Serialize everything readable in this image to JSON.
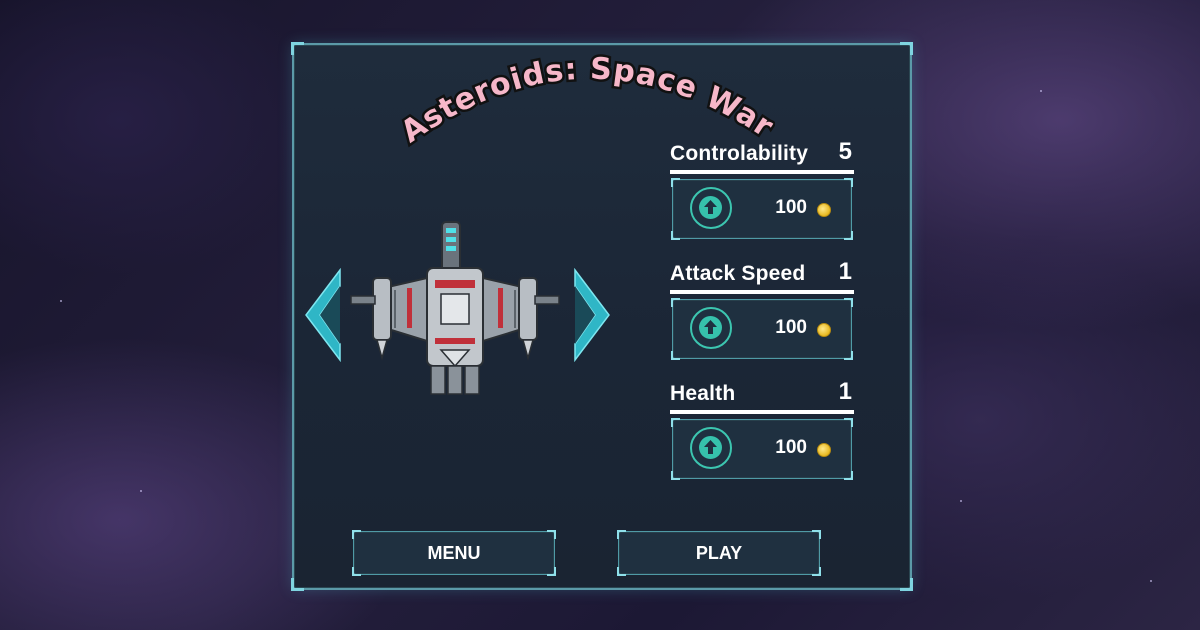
{
  "game": {
    "title": "Asteroids: Space War"
  },
  "navigation": {
    "prev_ship": "previous-ship",
    "next_ship": "next-ship"
  },
  "stats": [
    {
      "name": "Controlability",
      "level": "5",
      "price": "100"
    },
    {
      "name": "Attack Speed",
      "level": "1",
      "price": "100"
    },
    {
      "name": "Health",
      "level": "1",
      "price": "100"
    }
  ],
  "buttons": {
    "menu": "MENU",
    "play": "PLAY"
  },
  "colors": {
    "accent": "#3cc6b0",
    "panel_border": "#5b9aa8",
    "title_fill": "#f7b7c9",
    "title_outline": "#111111",
    "coin": "#e8b820"
  },
  "icons": {
    "upgrade": "arrow-up-circle-icon",
    "coin": "coin-icon",
    "prev": "chevron-left-icon",
    "next": "chevron-right-icon"
  }
}
